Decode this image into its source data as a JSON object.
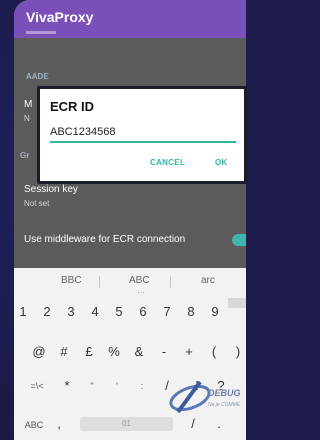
{
  "app": {
    "title": "VivaProxy"
  },
  "settings": {
    "category_1": "AADE",
    "row_1_title": "M",
    "row_1_sub": "N",
    "category_2": "Gr",
    "session_key_title": "Session key",
    "session_key_sub": "Not set",
    "middleware_title": "Use middleware for ECR connection"
  },
  "dialog": {
    "title": "ECR ID",
    "input_value": "ABC1234568",
    "cancel_label": "CANCEL",
    "ok_label": "OK"
  },
  "keyboard": {
    "suggestions": [
      "BBC",
      "ABC",
      "arc"
    ],
    "row_numbers": [
      "1",
      "2",
      "3",
      "4",
      "5",
      "6",
      "7",
      "8",
      "9"
    ],
    "row_symbols": [
      "@",
      "#",
      "£",
      "%",
      "&",
      "-",
      "+",
      "(",
      ")"
    ],
    "row_3": [
      "=\\<",
      "*",
      "\"",
      "'",
      ":",
      "/",
      "!",
      "?"
    ],
    "bottom_left": "ABC",
    "space_label": "01",
    "bottom_right": [
      "/",
      "."
    ]
  },
  "watermark": {
    "text": "DEBUG",
    "sub": "Na je COMME"
  },
  "colors": {
    "accent": "#32b3a6",
    "appbar": "#7a4fb8"
  }
}
